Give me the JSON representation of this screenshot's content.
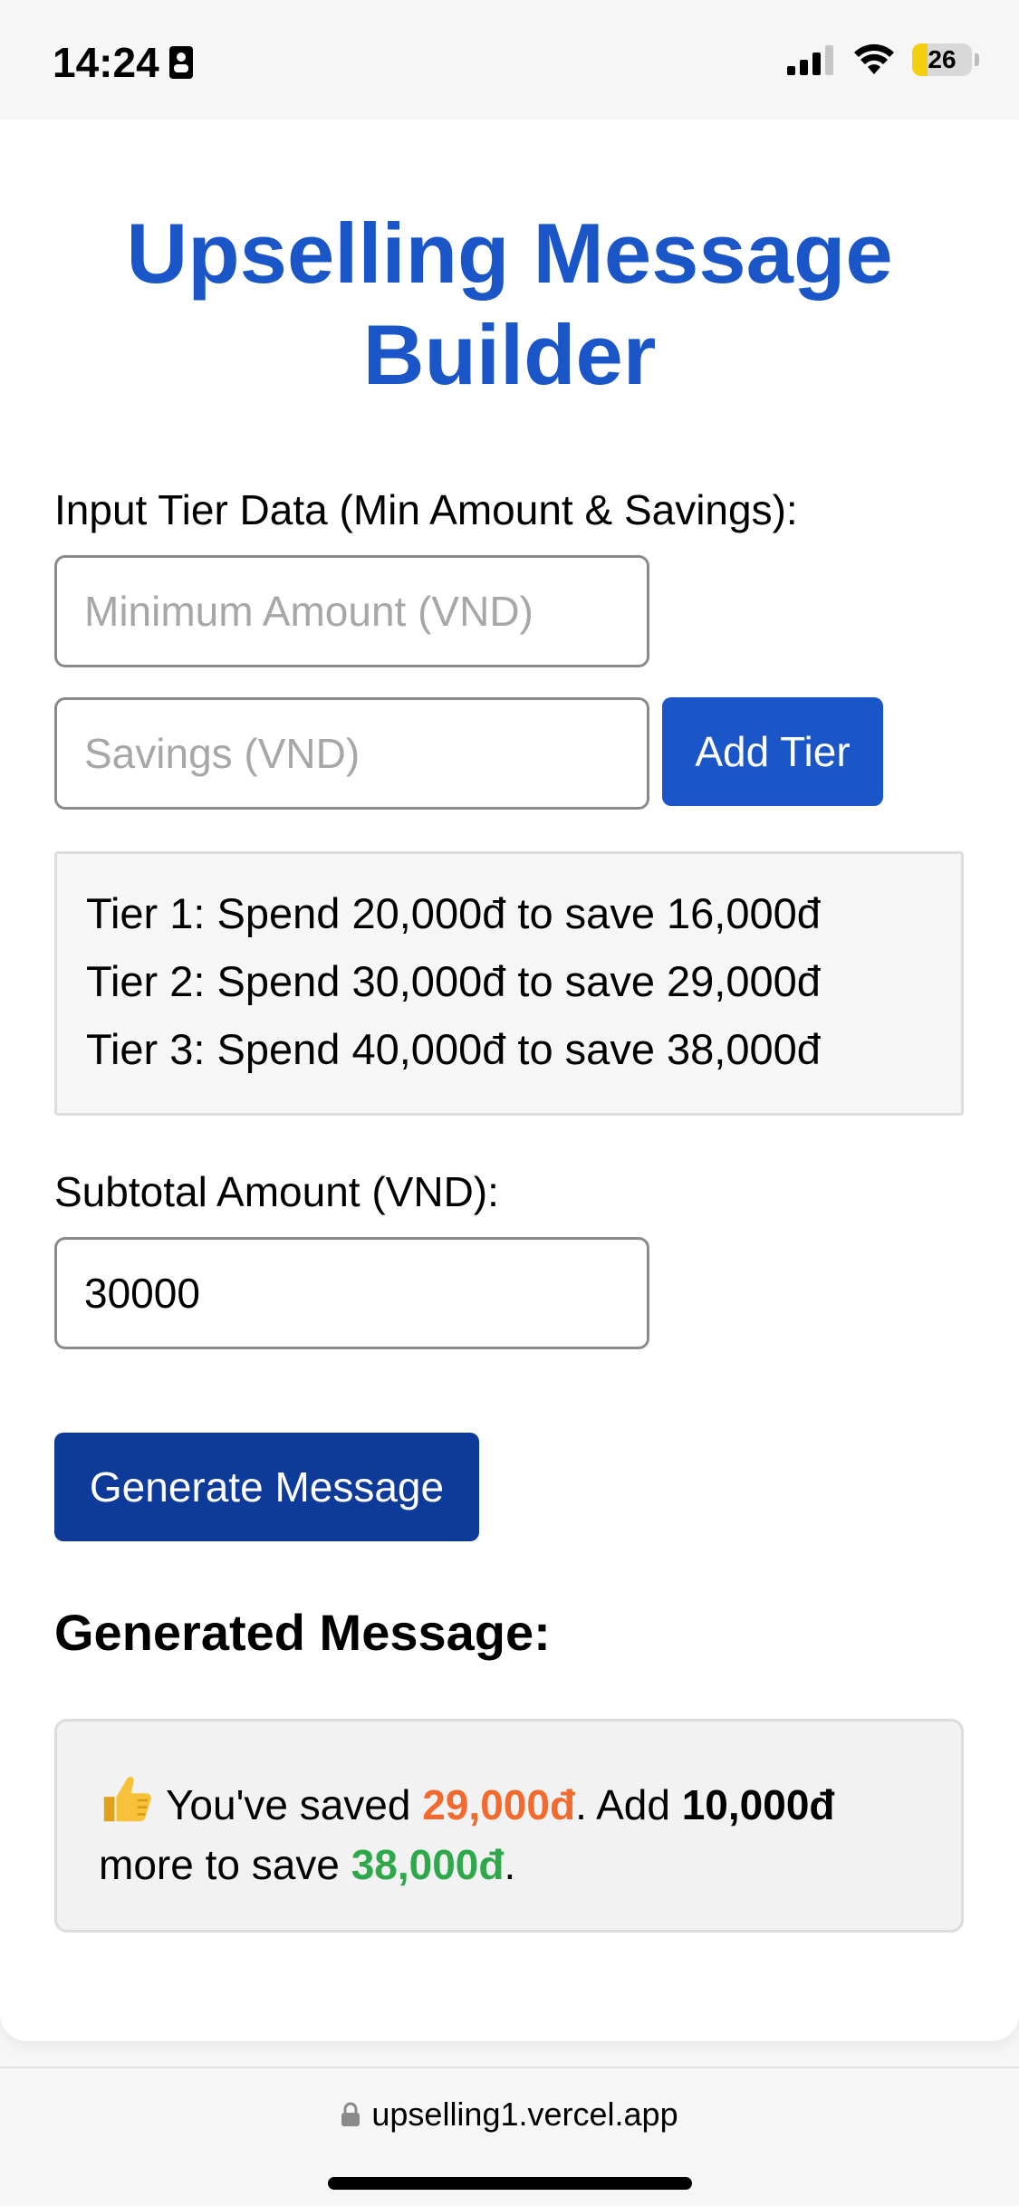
{
  "status_bar": {
    "time": "14:24",
    "battery": "26",
    "icons": [
      "contact-card-icon",
      "cellular-signal-icon",
      "wifi-icon",
      "battery-icon"
    ]
  },
  "page": {
    "title": "Upselling Message Builder"
  },
  "tier_input": {
    "label": "Input Tier Data (Min Amount & Savings):",
    "min_amount_placeholder": "Minimum Amount (VND)",
    "min_amount_value": "",
    "savings_placeholder": "Savings (VND)",
    "savings_value": "",
    "add_button": "Add Tier"
  },
  "tiers": [
    "Tier 1: Spend 20,000đ to save 16,000đ",
    "Tier 2: Spend 30,000đ to save 29,000đ",
    "Tier 3: Spend 40,000đ to save 38,000đ"
  ],
  "subtotal": {
    "label": "Subtotal Amount (VND):",
    "value": "30000"
  },
  "generate_button": "Generate Message",
  "generated": {
    "heading": "Generated Message:",
    "emoji_icon": "thumbs-up-icon",
    "part1": "You've saved ",
    "saved": "29,000đ",
    "part2": ". Add ",
    "add_amount": "10,000đ",
    "part3": " more to save ",
    "next_savings": "38,000đ",
    "part4": "."
  },
  "browser": {
    "url": "upselling1.vercel.app"
  },
  "colors": {
    "title_blue": "#1a56c8",
    "button_blue": "#1a56c8",
    "button_dark_blue": "#0e3a9a",
    "orange": "#f26a2e",
    "green": "#2ea84a",
    "battery_yellow": "#f4cf0f"
  }
}
